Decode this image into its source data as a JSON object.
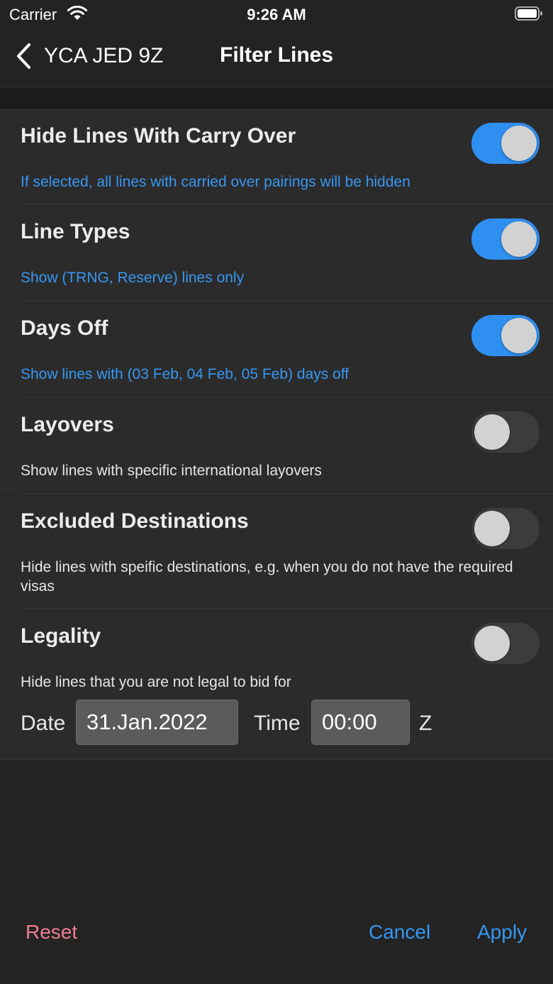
{
  "status_bar": {
    "carrier": "Carrier",
    "time": "9:26 AM"
  },
  "nav": {
    "back_label": "YCA JED 9Z",
    "title": "Filter Lines"
  },
  "filters": [
    {
      "title": "Hide Lines With Carry Over",
      "description": "If selected, all lines with carried over pairings will be hidden",
      "enabled": true
    },
    {
      "title": "Line Types",
      "description": "Show (TRNG, Reserve) lines only",
      "enabled": true
    },
    {
      "title": "Days Off",
      "description": "Show lines with (03 Feb, 04 Feb, 05 Feb) days off",
      "enabled": true
    },
    {
      "title": "Layovers",
      "description": "Show lines with specific international layovers",
      "enabled": false
    },
    {
      "title": "Excluded Destinations",
      "description": "Hide lines with speific destinations, e.g. when you do not have the required visas",
      "enabled": false
    },
    {
      "title": "Legality",
      "description": "Hide lines that you are not legal to bid for",
      "enabled": false
    }
  ],
  "legality_fields": {
    "date_label": "Date",
    "date_value": "31.Jan.2022",
    "time_label": "Time",
    "time_value": "00:00",
    "zone_suffix": "Z"
  },
  "footer": {
    "reset": "Reset",
    "cancel": "Cancel",
    "apply": "Apply"
  },
  "colors": {
    "background": "#232323",
    "row": "#2b2b2b",
    "accent_blue": "#3797f2",
    "toggle_on": "#2f8ff0",
    "reset_pink": "#f07e94"
  }
}
